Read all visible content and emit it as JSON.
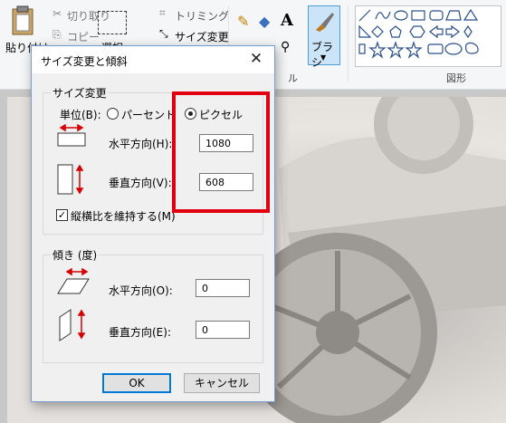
{
  "ribbon": {
    "paste_label": "貼り付け",
    "cut_label": "切り取り",
    "copy_label": "コピー",
    "select_label": "選択",
    "crop_label": "トリミング",
    "resize_label": "サイズ変更",
    "brush_label": "ブラシ",
    "shapes_group_label": "図形",
    "tools_group_partial": "ル",
    "brush_highlight_color": "#cce4f7"
  },
  "dialog": {
    "title": "サイズ変更と傾斜",
    "resize_section": {
      "legend": "サイズ変更",
      "unit_label": "単位(B):",
      "percent_label": "パーセント",
      "pixel_label": "ピクセル",
      "selected_unit": "ピクセル",
      "horizontal_label": "水平方向(H):",
      "horizontal_value": "1080",
      "vertical_label": "垂直方向(V):",
      "vertical_value": "608",
      "keep_ratio_label": "縦横比を維持する(M)",
      "keep_ratio_checked": true
    },
    "skew_section": {
      "legend": "傾き (度)",
      "horizontal_label": "水平方向(O):",
      "horizontal_value": "0",
      "vertical_label": "垂直方向(E):",
      "vertical_value": "0"
    },
    "ok_label": "OK",
    "cancel_label": "キャンセル"
  },
  "highlight_color": "#e0000f"
}
